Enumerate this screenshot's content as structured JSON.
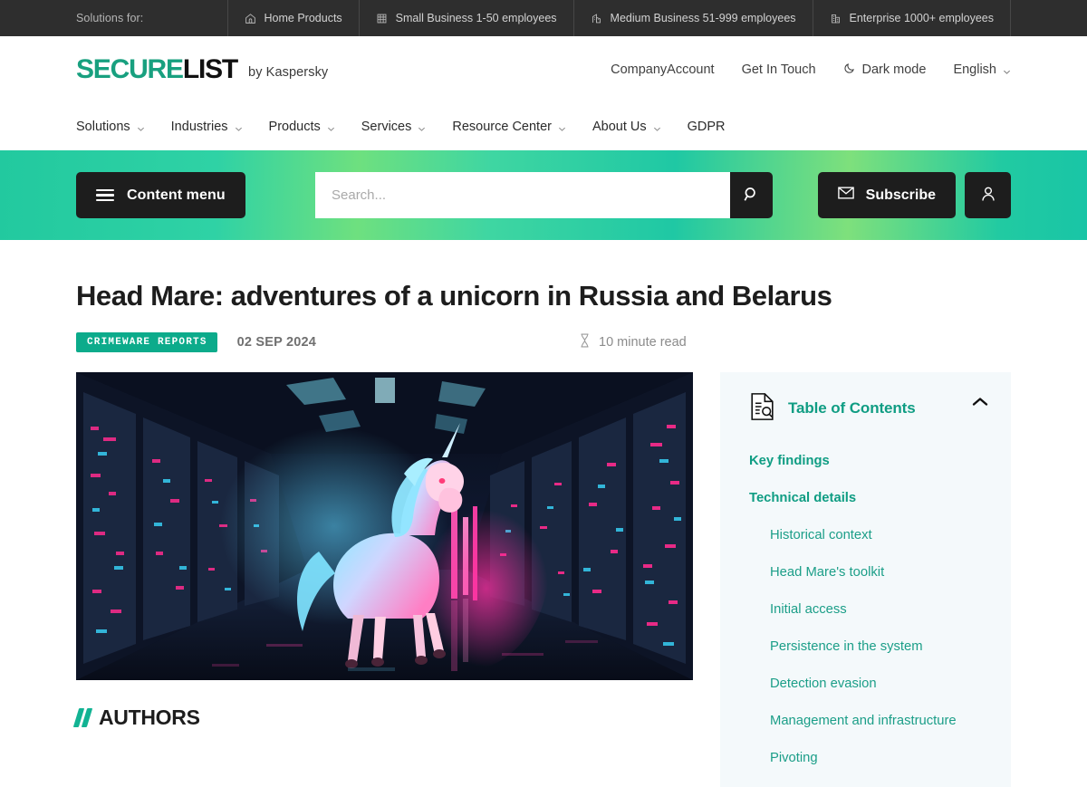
{
  "topbar": {
    "label": "Solutions for:",
    "segments": [
      {
        "icon": "home-icon",
        "label": "Home Products"
      },
      {
        "icon": "small-building-icon",
        "label": "Small Business 1-50 employees"
      },
      {
        "icon": "medium-building-icon",
        "label": "Medium Business 51-999 employees"
      },
      {
        "icon": "enterprise-building-icon",
        "label": "Enterprise 1000+ employees"
      }
    ]
  },
  "header": {
    "logo_primary": "SECURE",
    "logo_secondary": "LIST",
    "logo_byline": "by Kaspersky",
    "right_items": [
      {
        "label": "CompanyAccount",
        "icon": ""
      },
      {
        "label": "Get In Touch",
        "icon": ""
      },
      {
        "label": "Dark mode",
        "icon": "moon-icon"
      },
      {
        "label": "English",
        "icon": "chevron-down-icon"
      }
    ]
  },
  "mainnav": {
    "items": [
      {
        "label": "Solutions",
        "caret": true
      },
      {
        "label": "Industries",
        "caret": true
      },
      {
        "label": "Products",
        "caret": true
      },
      {
        "label": "Services",
        "caret": true
      },
      {
        "label": "Resource Center",
        "caret": true
      },
      {
        "label": "About Us",
        "caret": true
      },
      {
        "label": "GDPR",
        "caret": false
      }
    ]
  },
  "band": {
    "content_menu_label": "Content menu",
    "search_placeholder": "Search...",
    "search_value": "",
    "subscribe_label": "Subscribe",
    "gradient_from": "#22c99f",
    "gradient_mid": "#6ee07f",
    "gradient_to": "#19c5a6"
  },
  "article": {
    "title": "Head Mare: adventures of a unicorn in Russia and Belarus",
    "category_badge": "CRIMEWARE REPORTS",
    "badge_color": "#0cab8b",
    "date": "02 SEP 2024",
    "read_time": "10 minute read",
    "hero_alt": "Neon unicorn standing in a dark cyberpunk data center corridor",
    "authors_heading": "AUTHORS"
  },
  "toc": {
    "title": "Table of Contents",
    "accent_color": "#0f9d83",
    "collapsed": false,
    "items": [
      {
        "label": "Key findings",
        "level": 1
      },
      {
        "label": "Technical details",
        "level": 1
      },
      {
        "label": "Historical context",
        "level": 2
      },
      {
        "label": "Head Mare's toolkit",
        "level": 2
      },
      {
        "label": "Initial access",
        "level": 2
      },
      {
        "label": "Persistence in the system",
        "level": 2
      },
      {
        "label": "Detection evasion",
        "level": 2
      },
      {
        "label": "Management and infrastructure",
        "level": 2
      },
      {
        "label": "Pivoting",
        "level": 2
      }
    ]
  }
}
